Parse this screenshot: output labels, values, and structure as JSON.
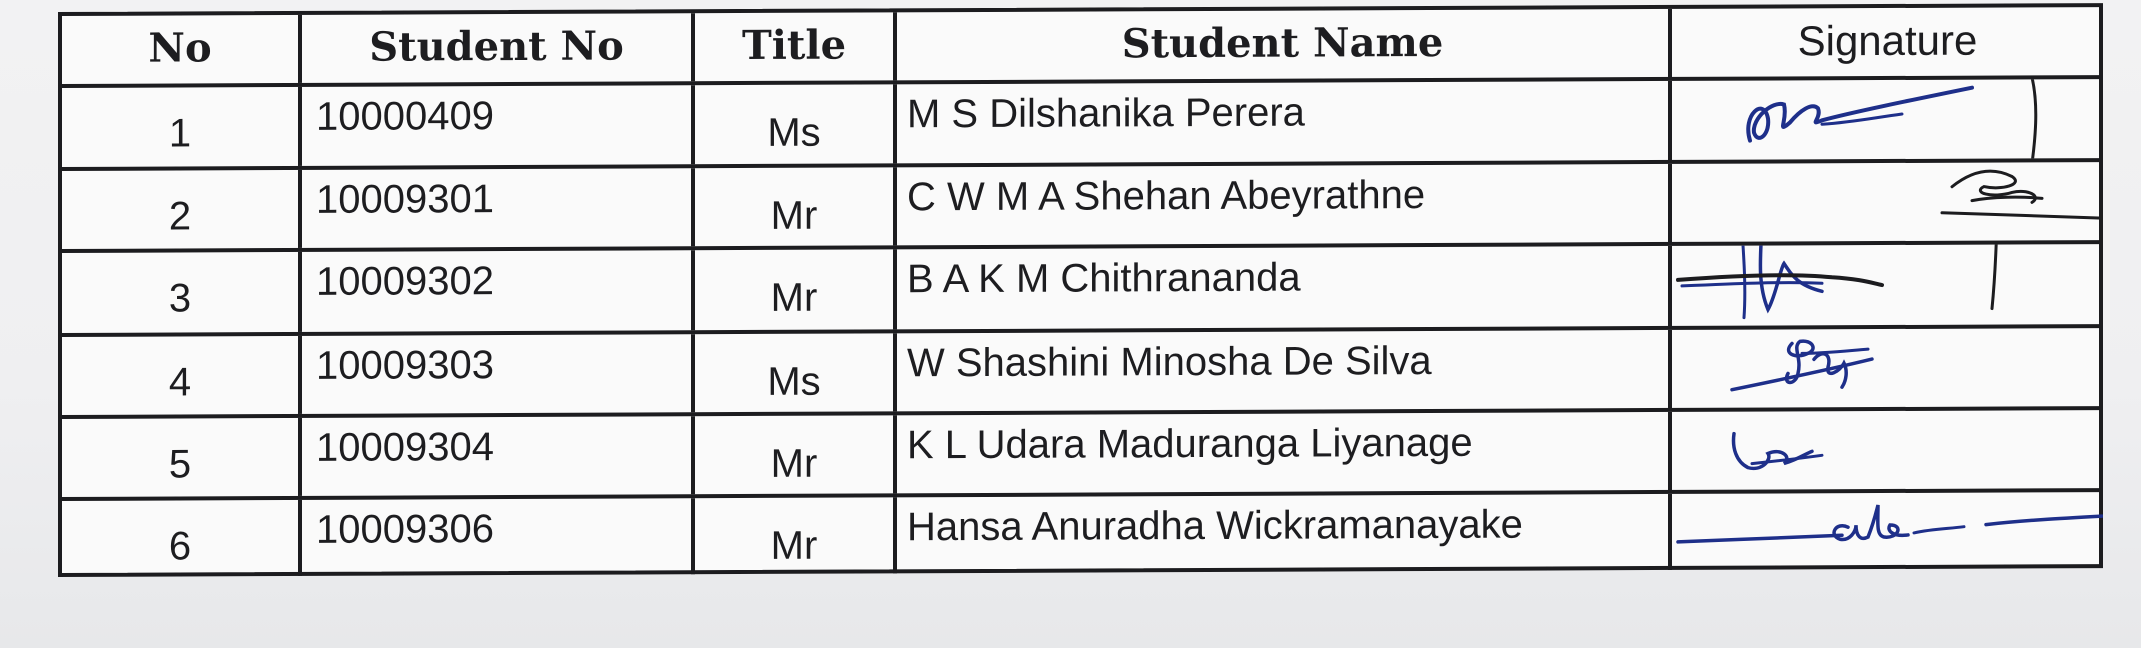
{
  "headers": {
    "no": "No",
    "student_no": "Student No",
    "title": "Title",
    "student_name": "Student Name",
    "signature": "Signature"
  },
  "rows": [
    {
      "no": "1",
      "student_no": "10000409",
      "title": "Ms",
      "name": "M S Dilshanika  Perera"
    },
    {
      "no": "2",
      "student_no": "10009301",
      "title": "Mr",
      "name": "C W M  A Shehan Abeyrathne"
    },
    {
      "no": "3",
      "student_no": "10009302",
      "title": "Mr",
      "name": "B A K M  Chithrananda"
    },
    {
      "no": "4",
      "student_no": "10009303",
      "title": "Ms",
      "name": "W Shashini Minosha  De Silva"
    },
    {
      "no": "5",
      "student_no": "10009304",
      "title": "Mr",
      "name": "K L Udara Maduranga  Liyanage"
    },
    {
      "no": "6",
      "student_no": "10009306",
      "title": "Mr",
      "name": "Hansa Anuradha  Wickramanayake"
    }
  ],
  "colors": {
    "ink": "#1c1c1f",
    "signature_ink": "#1e2f8a",
    "paper": "#fafafa"
  }
}
